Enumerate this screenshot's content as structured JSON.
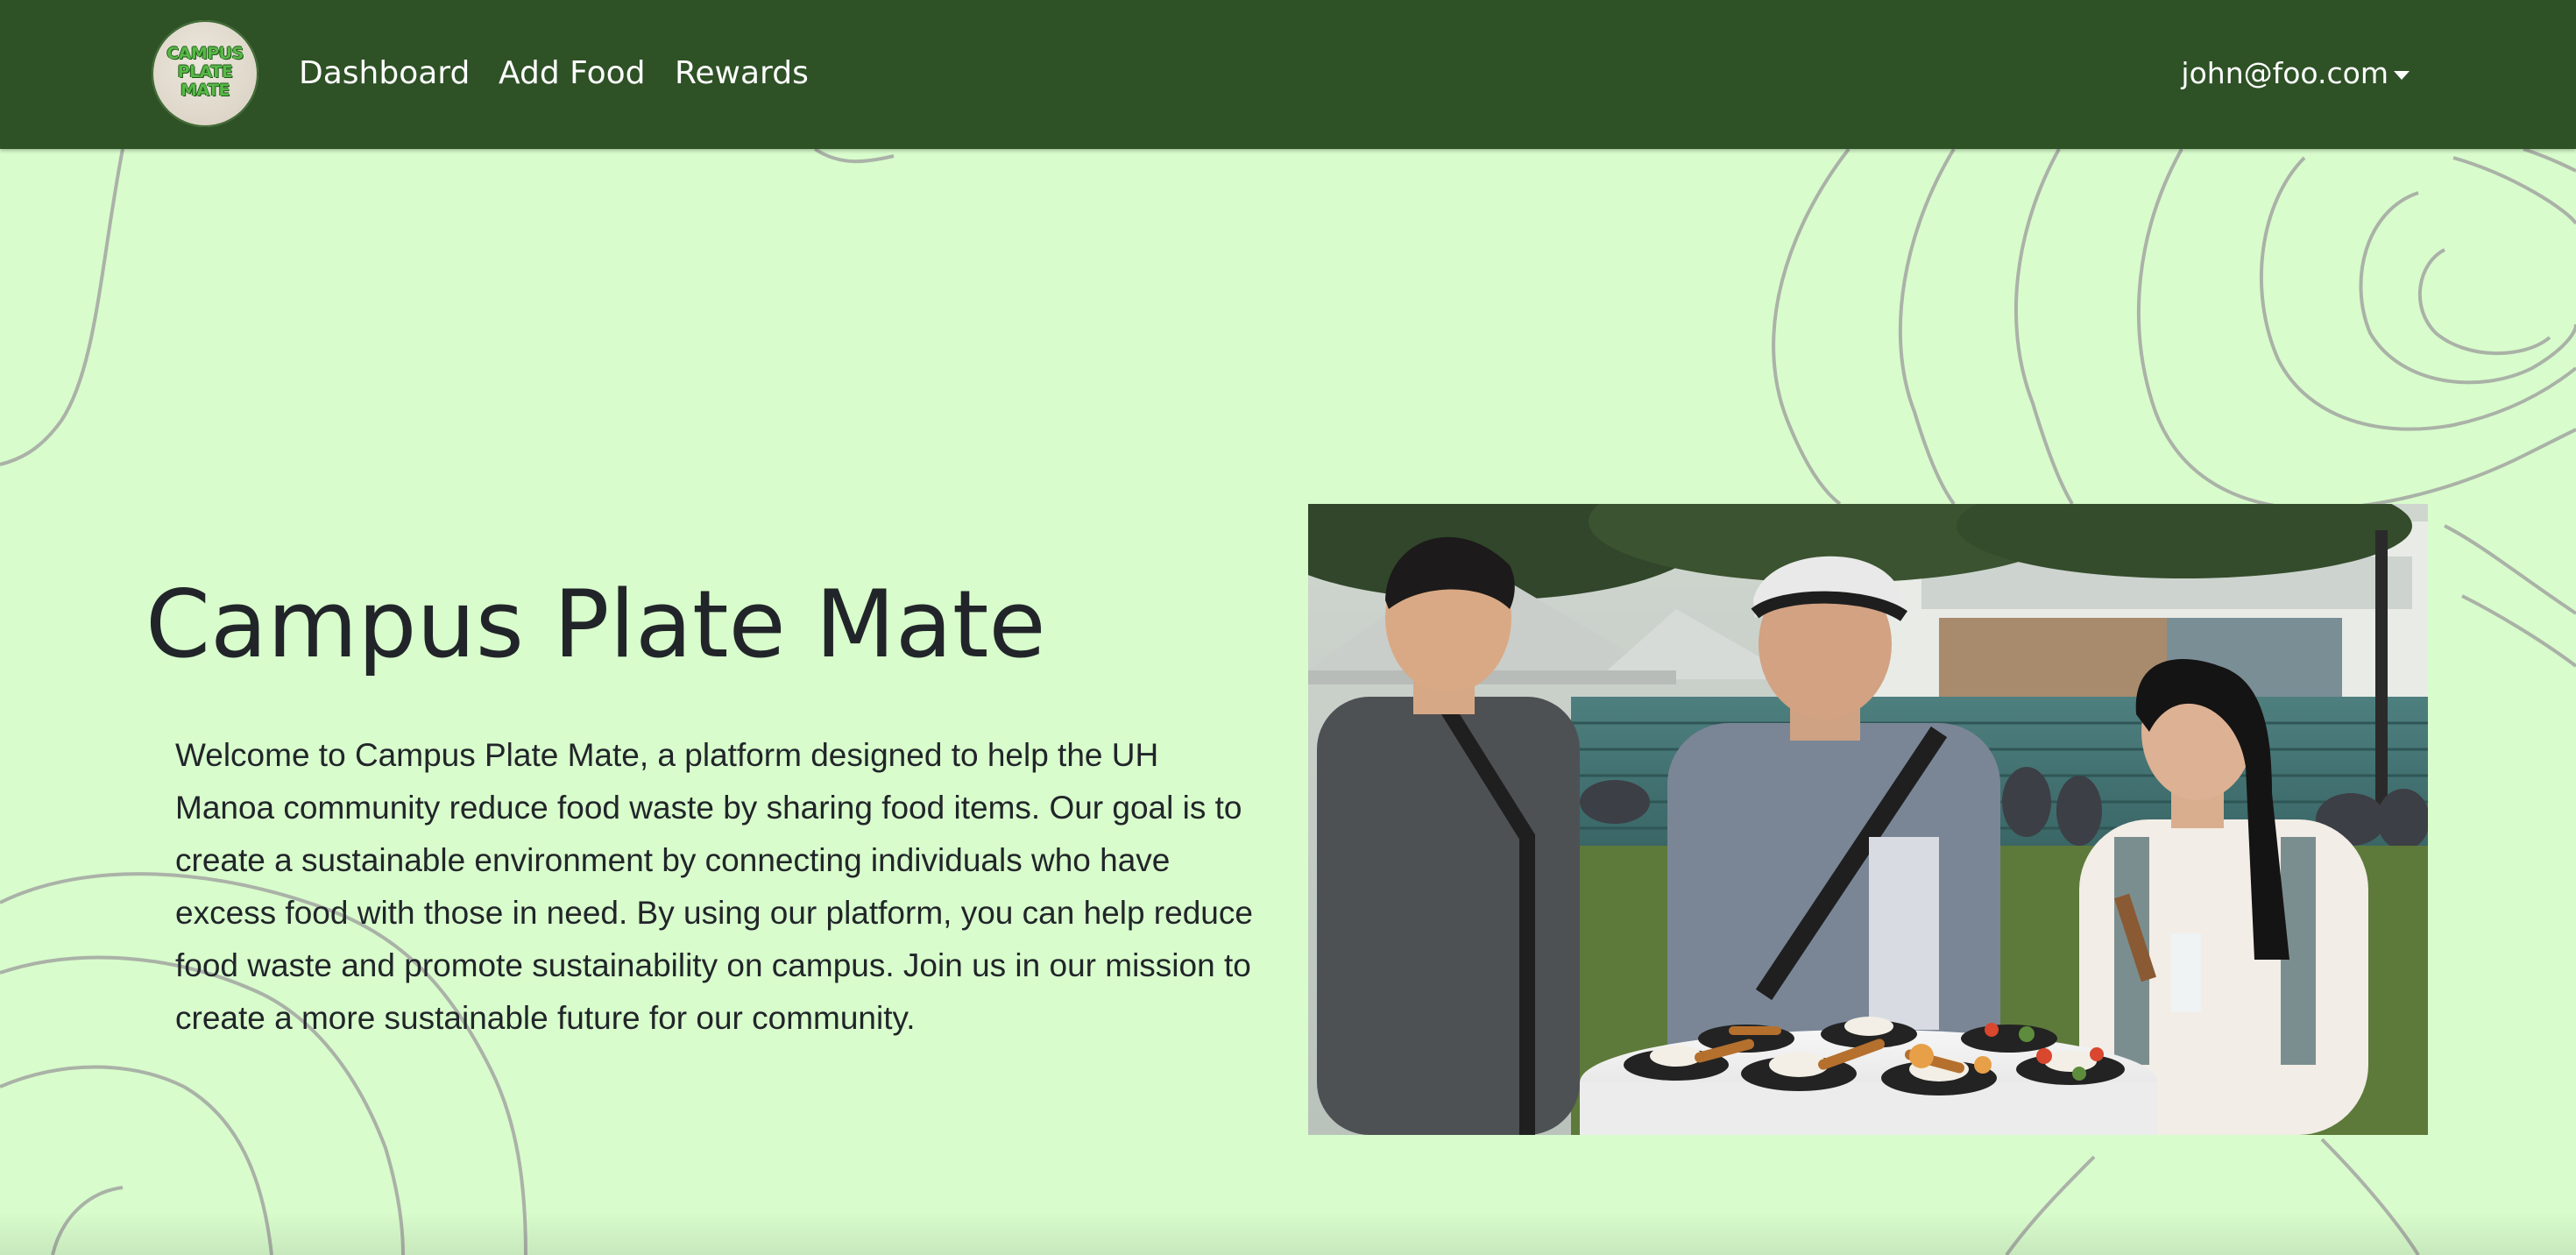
{
  "navbar": {
    "logo_lines": [
      "CAMPUS",
      "PLATE",
      "MATE"
    ],
    "links": [
      {
        "label": "Dashboard"
      },
      {
        "label": "Add Food"
      },
      {
        "label": "Rewards"
      }
    ],
    "user_email": "john@foo.com",
    "bg_color": "#2e5126"
  },
  "main": {
    "title": "Campus Plate Mate",
    "intro": "Welcome to Campus Plate Mate, a platform designed to help the UH Manoa community reduce food waste by sharing food items. Our goal is to create a sustainable environment by connecting individuals who have excess food with those in need. By using our platform, you can help reduce food waste and promote sustainability on campus. Join us in our mission to create a more sustainable future for our community.",
    "bg_color": "#d8fccc"
  }
}
